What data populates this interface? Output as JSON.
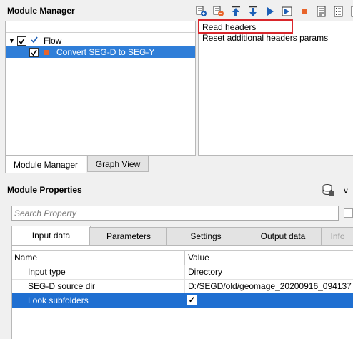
{
  "module_manager": {
    "title": "Module Manager",
    "toolbar": [
      {
        "icon": "add-module-icon"
      },
      {
        "icon": "remove-module-icon"
      },
      {
        "icon": "move-up-icon"
      },
      {
        "icon": "move-down-icon"
      },
      {
        "icon": "run-icon"
      },
      {
        "icon": "run-step-icon"
      },
      {
        "icon": "stop-icon"
      },
      {
        "icon": "log-icon"
      },
      {
        "icon": "list-icon"
      },
      {
        "icon": "settings-icon"
      }
    ],
    "tree": {
      "root_label": "Flow",
      "child_label": "Convert SEG-D to SEG-Y"
    },
    "modules": [
      "Read headers",
      "Reset additional headers params"
    ],
    "tabs": [
      "Module Manager",
      "Graph View"
    ]
  },
  "module_properties": {
    "title": "Module Properties",
    "search_placeholder": "Search Property",
    "tabs": [
      "Input data",
      "Parameters",
      "Settings",
      "Output data",
      "Info"
    ],
    "columns": {
      "name": "Name",
      "value": "Value"
    },
    "rows": [
      {
        "name": "Input type",
        "value": "Directory"
      },
      {
        "name": "SEG-D source dir",
        "value": "D:/SEGD/old/geomage_20200916_094137"
      },
      {
        "name": "Look subfolders",
        "value": "✓"
      }
    ]
  },
  "colors": {
    "selection": "#2f7ed8",
    "highlight_box": "#d9262b",
    "accent_blue": "#1d5fb6",
    "accent_orange": "#e8642a"
  }
}
